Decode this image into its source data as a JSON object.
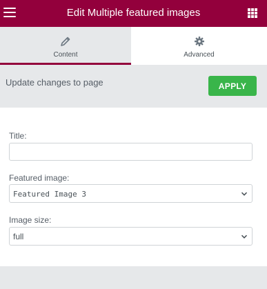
{
  "header": {
    "title": "Edit Multiple featured images",
    "menu_icon": "hamburger-icon",
    "apps_icon": "grid-apps-icon",
    "bg_color": "#93003c"
  },
  "tabs": [
    {
      "label": "Content",
      "icon": "pencil-icon",
      "active": true
    },
    {
      "label": "Advanced",
      "icon": "gear-icon",
      "active": false
    }
  ],
  "apply_bar": {
    "text": "Update changes to page",
    "button_label": "APPLY",
    "button_color": "#39b54a"
  },
  "form": {
    "title_label": "Title:",
    "title_value": "",
    "featured_image_label": "Featured image:",
    "featured_image_value": "Featured Image 3",
    "image_size_label": "Image size:",
    "image_size_value": "full"
  }
}
